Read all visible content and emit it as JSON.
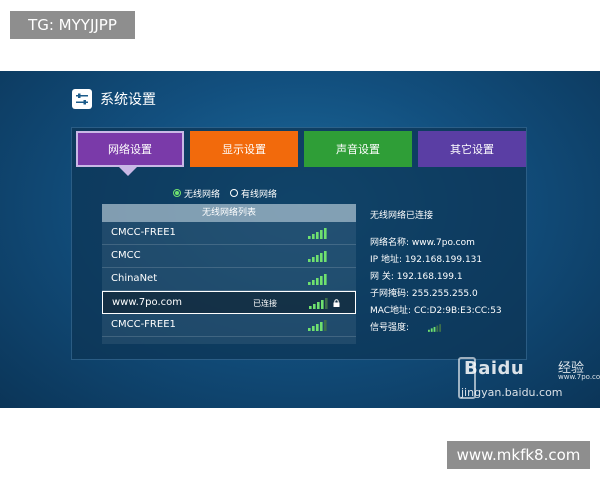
{
  "overlay": {
    "top_tag": "TG: MYYJJPP",
    "bottom_tag": "www.mkfk8.com"
  },
  "window": {
    "title": "系统设置",
    "title_icon": "sliders-icon"
  },
  "tabs": [
    {
      "label": "网络设置",
      "active": true,
      "color": "#7a3aa9"
    },
    {
      "label": "显示设置",
      "color": "#f26a0c"
    },
    {
      "label": "声音设置",
      "color": "#2f9e37"
    },
    {
      "label": "其它设置",
      "color": "#5a3ea4"
    }
  ],
  "connection_type": {
    "options": [
      "无线网络",
      "有线网络"
    ],
    "selected": "无线网络"
  },
  "wifi_list": {
    "header": "无线网络列表",
    "networks": [
      {
        "ssid": "CMCC-FREE1",
        "status": "",
        "signal_bars": 5,
        "locked": false
      },
      {
        "ssid": "CMCC",
        "status": "",
        "signal_bars": 5,
        "locked": false
      },
      {
        "ssid": "ChinaNet",
        "status": "",
        "signal_bars": 5,
        "locked": false
      },
      {
        "ssid": "www.7po.com",
        "status": "已连接",
        "signal_bars": 4,
        "locked": true,
        "selected": true
      },
      {
        "ssid": "CMCC-FREE1",
        "status": "",
        "signal_bars": 4,
        "locked": false
      }
    ]
  },
  "connection_info": {
    "title": "无线网络已连接",
    "lines": [
      "网络名称: www.7po.com",
      "IP 地址: 192.168.199.131",
      "网       关: 192.168.199.1",
      "子网掩码: 255.255.255.0",
      "MAC地址: CC:D2:9B:E3:CC:53"
    ],
    "signal_label": "信号强度:",
    "signal_bars": 3
  },
  "watermark": {
    "brand": "Baidu",
    "sub": "经验",
    "site_small": "www.7po.com",
    "domain": "jingyan.baidu.com"
  },
  "colors": {
    "signal_green": "#6fe16f",
    "signal_dim": "#3d6f4a"
  }
}
